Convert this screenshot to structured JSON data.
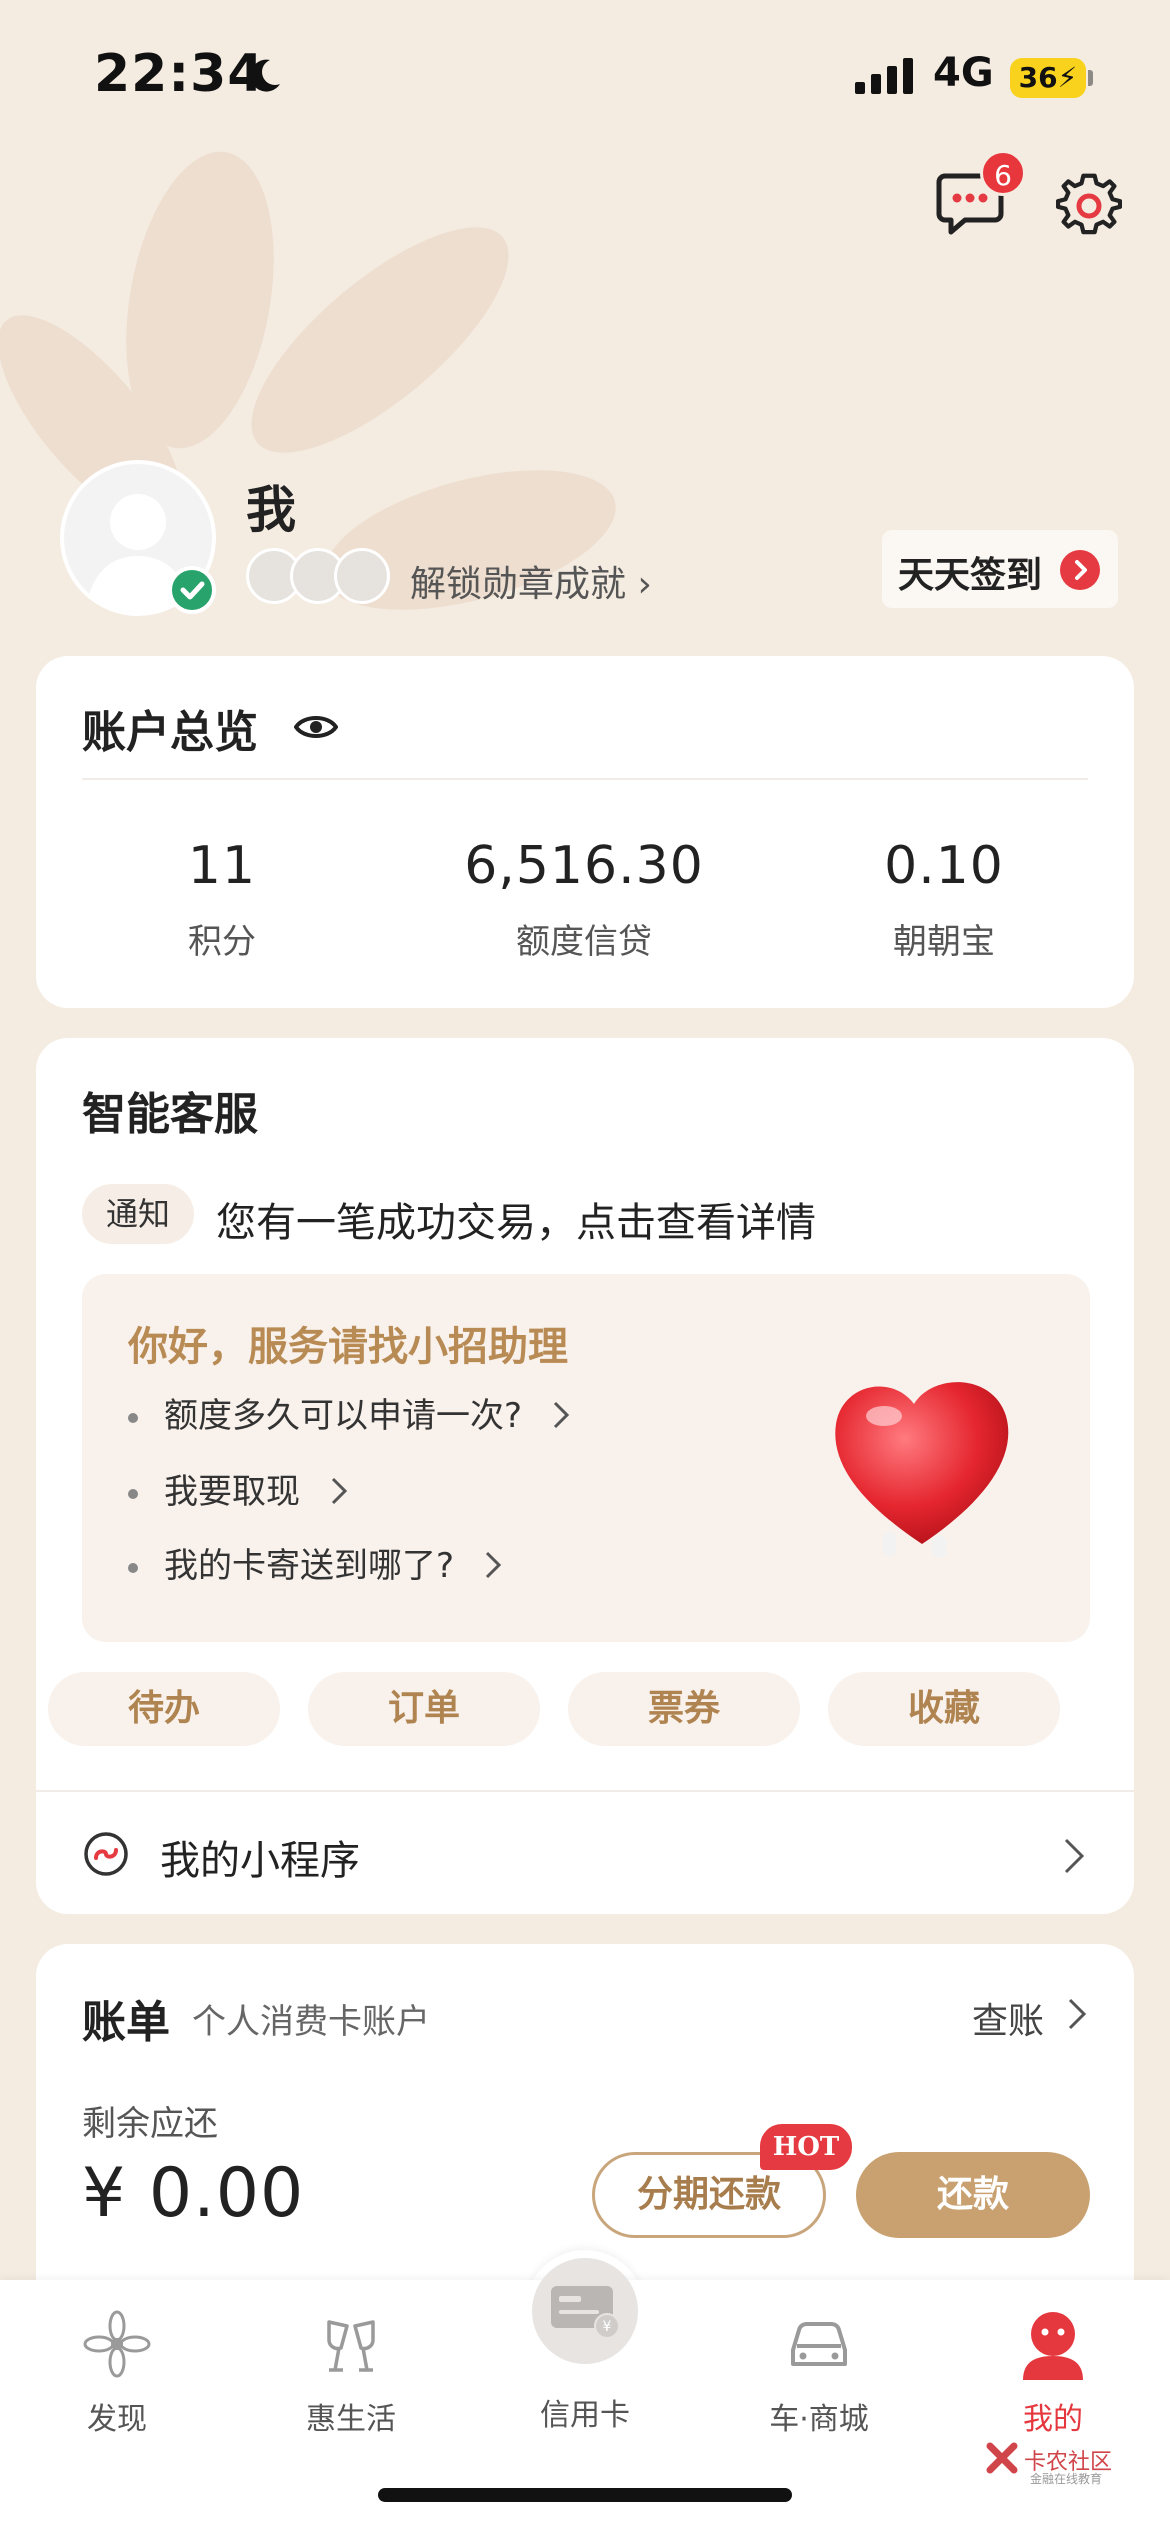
{
  "status_bar": {
    "time": "22:34",
    "network": "4G",
    "battery": "36"
  },
  "header": {
    "message_badge": "6"
  },
  "profile": {
    "name": "我",
    "achievement_link": "解锁勋章成就 ›",
    "checkin_label": "天天签到"
  },
  "overview": {
    "title": "账户总览",
    "stats": [
      {
        "value": "11",
        "label": "积分"
      },
      {
        "value": "6,516.30",
        "label": "额度信贷"
      },
      {
        "value": "0.10",
        "label": "朝朝宝"
      }
    ]
  },
  "service": {
    "title": "智能客服",
    "notice_tag": "通知",
    "notice_text": "您有一笔成功交易，点击查看详情",
    "assistant_title": "你好，服务请找小招助理",
    "questions": [
      "额度多久可以申请一次?",
      "我要取现",
      "我的卡寄送到哪了?"
    ],
    "pills": [
      "待办",
      "订单",
      "票券",
      "收藏"
    ],
    "mini_program": "我的小程序"
  },
  "bill": {
    "title": "账单",
    "subtitle": "个人消费卡账户",
    "link": "查账",
    "due_label": "剩余应还",
    "amount": "¥ 0.00",
    "install_btn": "分期还款",
    "hot_tag": "HOT",
    "repay_btn": "还款"
  },
  "tabbar": {
    "tabs": [
      "发现",
      "惠生活",
      "信用卡",
      "车·商城",
      "我的"
    ],
    "active": "我的"
  },
  "watermark": {
    "text": "卡农社区",
    "sub": "金融在线教育"
  },
  "colors": {
    "accent_red": "#e5383e",
    "gold": "#c9a170",
    "background": "#f4ebe1"
  }
}
